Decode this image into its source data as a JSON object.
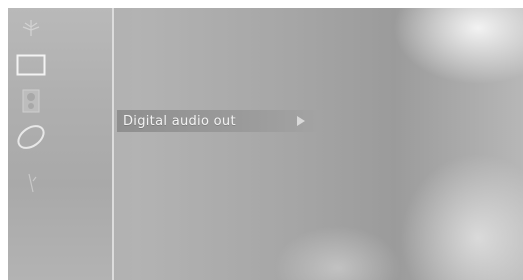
{
  "sidebar": {
    "icons": [
      {
        "name": "antenna-icon"
      },
      {
        "name": "picture-icon",
        "selected": true
      },
      {
        "name": "speaker-icon"
      },
      {
        "name": "disc-icon"
      },
      {
        "name": "features-icon"
      }
    ]
  },
  "menu": {
    "items": [
      {
        "label": "Digital audio out",
        "has_submenu": true
      }
    ]
  },
  "colors": {
    "highlight": "#8f8f8f",
    "text": "#f2f2f2"
  }
}
